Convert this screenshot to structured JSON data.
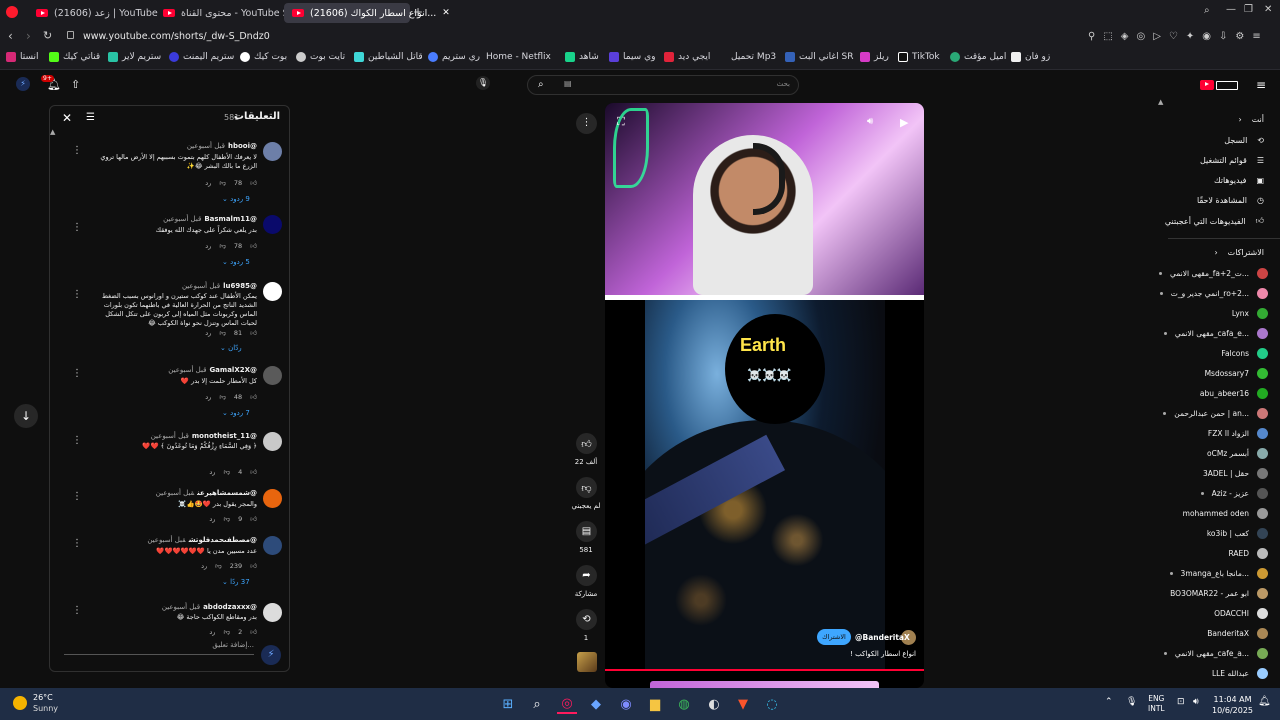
{
  "browser": {
    "tabs": [
      {
        "label": "(21606) زعد | YouTube"
      },
      {
        "label": "محتوى القناة - YouTube Studio"
      },
      {
        "label": "(21606) انواع اسطار الكواك...",
        "active": true
      }
    ],
    "new_tab": "+",
    "url": "www.youtube.com/shorts/_dw-S_Dndz0",
    "bookmarks": [
      "انستا",
      "قناتي كيك",
      "ستريم لاير",
      "ستريم اليمنت",
      "بوت كيك",
      "تايت بوت",
      "قاتل الشياطين",
      "ري ستريم",
      "Home - Netflix",
      "شاهد",
      "وي سيما",
      "ايجي ديد",
      "تحميل Mp3",
      "اغاني البت SR",
      "ريلز",
      "TikTok",
      "اميل مؤقت",
      "زو فان"
    ]
  },
  "youtube": {
    "search_placeholder": "بحث",
    "notifications_badge": "9+",
    "comments": {
      "title": "التعليقات",
      "count": "581",
      "add_placeholder": "إضافة تعليق...",
      "items": [
        {
          "user": "@hbooi",
          "time": "قبل أسبوعين",
          "text": "لا يعرفك الأطفال كلهم بتموت بسببهم إلا الأرض مالها تروي الزرع ما بالك البشر 😂✨",
          "likes": "78",
          "replies": "9 ردود"
        },
        {
          "user": "@Basmalm11",
          "time": "قبل أسبوعين",
          "text": "بدر يلعي شكراً على جهدك الله يوفقك",
          "likes": "78",
          "replies": "5 ردود"
        },
        {
          "user": "@lu6985",
          "time": "قبل أسبوعين",
          "text": "يمكن الأطفال عند كوكب ستيرن و اورانوس بسبب الضغط الشديد الناتج من الحرارة العالية في باطنهما تكون بلورات الماس وكربونات مثل المياه إلى كربون على تتكل الشكل لحبات الماس وتنزل نحو نواة الكوكب 😂",
          "likes": "81",
          "replies": "ردّان"
        },
        {
          "user": "@GamalX2X",
          "time": "قبل أسبوعين",
          "text": "كل الأمطار حلمت إلا بدر ❤️",
          "likes": "48",
          "replies": "7 ردود"
        },
        {
          "user": "@monotheist_11",
          "time": "قبل أسبوعين",
          "text": "﴿ وَفِي السَّمَاءِ رِزْقُكُمْ وَمَا تُوعَدُونَ ﴾ ❤️❤️",
          "likes": "4",
          "replies": ""
        },
        {
          "user": "@شمسمشاهيرعن",
          "time": "قبل أسبوعين",
          "text": "والمجر يقول بدر ❤️🤩👍☠️",
          "likes": "9",
          "replies": ""
        },
        {
          "user": "@مصطفىحمدفلوتش",
          "time": "قبل أسبوعين",
          "text": "عدد مسيين مدن يا ❤️❤️❤️❤️❤️❤️",
          "likes": "239",
          "replies": "37 ردًا"
        },
        {
          "user": "@abdodzaxxx",
          "time": "قبل أسبوعين",
          "text": "بدر ومقاطع الكواكب حاجة 😂",
          "likes": "2",
          "replies": ""
        }
      ]
    },
    "short": {
      "overlay_text": "Earth",
      "skulls": "☠️☠️☠️",
      "channel": "@BanderitaX",
      "subscribe": "الاشتراك",
      "caption": "انواع اسطار الكواكب !",
      "likes": "22 ألف",
      "dislike": "لم يعجبني",
      "comments": "581",
      "share": "مشاركة",
      "remix": "1"
    },
    "sidebar": {
      "you_header": "أنت",
      "you_items": [
        "السجل",
        "قوائم التشغيل",
        "فيديوهاتك",
        "المشاهدة لاحقًا",
        "الفيديوهات التي أعجبتني"
      ],
      "subs_header": "الاشتراكات",
      "subscriptions": [
        "مقهى الانمي_fa+2_ت...",
        "انمي جدير و_ت_ro+2...",
        "Lynx",
        "مقهى الانمي_cafa_e...",
        "Falcons",
        "Msdossary7",
        "abu_abeer16",
        "حمن عبدالرحمن | an...",
        "FZX ll الزواد",
        "oCMz أبسمر",
        "3ADEL | حقل",
        "Aziz - عزيز",
        "mohammed oden",
        "ko3ib | كعب",
        "RAED",
        "3manga_مانجا باع...",
        "BO3OMAR22 - ابو عمر",
        "ODACCHI",
        "BanderitaX",
        "مقهى الانمي_cafe_a...",
        "LLE عبدالله"
      ]
    }
  },
  "taskbar": {
    "weather_temp": "26°C",
    "weather_desc": "Sunny",
    "lang": "ENG",
    "layout": "INTL",
    "time": "11:04 AM",
    "date": "10/6/2025"
  }
}
